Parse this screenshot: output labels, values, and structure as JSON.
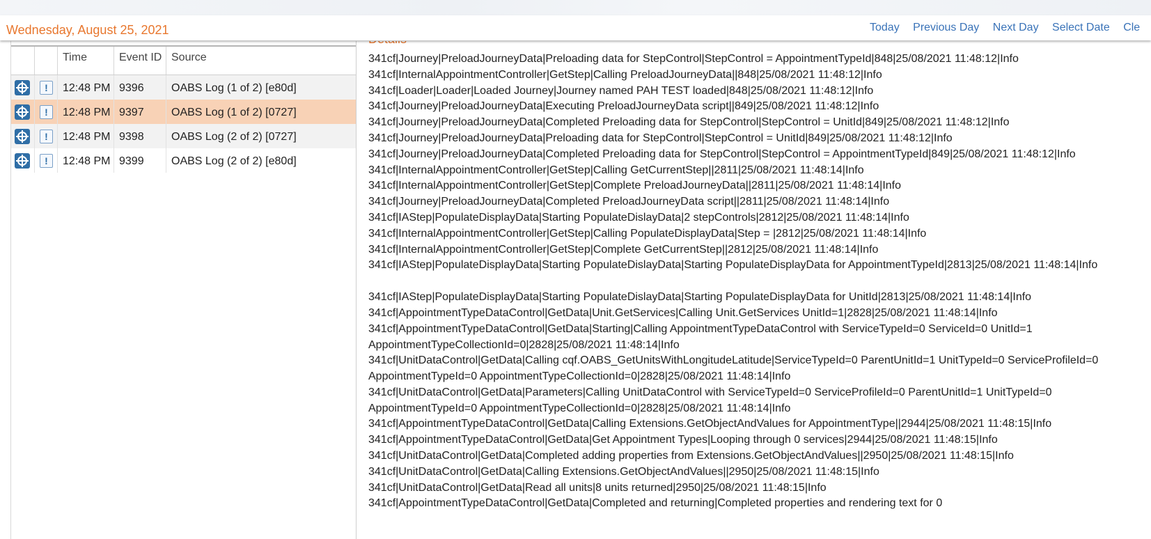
{
  "header": {
    "date": "Wednesday, August 25, 2021",
    "nav": [
      "Today",
      "Previous Day",
      "Next Day",
      "Select Date",
      "Cle"
    ]
  },
  "events_table": {
    "columns": [
      "",
      "",
      "Time",
      "Event ID",
      "Source"
    ],
    "rows": [
      {
        "time": "12:48 PM",
        "event_id": "9396",
        "source": "OABS Log (1 of 2) [e80d]",
        "selected": false
      },
      {
        "time": "12:48 PM",
        "event_id": "9397",
        "source": "OABS Log (1 of 2) [0727]",
        "selected": true
      },
      {
        "time": "12:48 PM",
        "event_id": "9398",
        "source": "OABS Log (2 of 2) [0727]",
        "selected": false
      },
      {
        "time": "12:48 PM",
        "event_id": "9399",
        "source": "OABS Log (2 of 2) [e80d]",
        "selected": false
      }
    ],
    "row_icons": [
      "target-icon",
      "info-icon"
    ]
  },
  "details": {
    "heading": "Details",
    "lines": [
      "341cf|Journey|PreloadJourneyData|Preloading data for StepControl|StepControl = AppointmentTypeId|848|25/08/2021 11:48:12|Info",
      "341cf|InternalAppointmentController|GetStep|Calling PreloadJourneyData||848|25/08/2021 11:48:12|Info",
      "341cf|Loader|Loader|Loaded Journey|Journey named PAH TEST loaded|848|25/08/2021 11:48:12|Info",
      "341cf|Journey|PreloadJourneyData|Executing PreloadJourneyData script||849|25/08/2021 11:48:12|Info",
      "341cf|Journey|PreloadJourneyData|Completed Preloading data for StepControl|StepControl = UnitId|849|25/08/2021 11:48:12|Info",
      "341cf|Journey|PreloadJourneyData|Preloading data for StepControl|StepControl = UnitId|849|25/08/2021 11:48:12|Info",
      "341cf|Journey|PreloadJourneyData|Completed Preloading data for StepControl|StepControl = AppointmentTypeId|849|25/08/2021 11:48:12|Info",
      "341cf|InternalAppointmentController|GetStep|Calling GetCurrentStep||2811|25/08/2021 11:48:14|Info",
      "341cf|InternalAppointmentController|GetStep|Complete PreloadJourneyData||2811|25/08/2021 11:48:14|Info",
      "341cf|Journey|PreloadJourneyData|Completed PreloadJourneyData script||2811|25/08/2021 11:48:14|Info",
      "341cf|IAStep|PopulateDisplayData|Starting PopulateDislayData|2 stepControls|2812|25/08/2021 11:48:14|Info",
      "341cf|InternalAppointmentController|GetStep|Calling PopulateDisplayData|Step = |2812|25/08/2021 11:48:14|Info",
      "341cf|InternalAppointmentController|GetStep|Complete GetCurrentStep||2812|25/08/2021 11:48:14|Info",
      "341cf|IAStep|PopulateDisplayData|Starting PopulateDislayData|Starting PopulateDisplayData for AppointmentTypeId|2813|25/08/2021 11:48:14|Info",
      "341cf|IAStep|PopulateDisplayData|Starting PopulateDislayData|Starting PopulateDisplayData for UnitId|2813|25/08/2021 11:48:14|Info",
      "341cf|AppointmentTypeDataControl|GetData|Unit.GetServices|Calling Unit.GetServices UnitId=1|2828|25/08/2021 11:48:14|Info",
      "341cf|AppointmentTypeDataControl|GetData|Starting|Calling AppointmentTypeDataControl with ServiceTypeId=0 ServiceId=0 UnitId=1 AppointmentTypeCollectionId=0|2828|25/08/2021 11:48:14|Info",
      "341cf|UnitDataControl|GetData|Calling cqf.OABS_GetUnitsWithLongitudeLatitude|ServiceTypeId=0 ParentUnitId=1 UnitTypeId=0 ServiceProfileId=0 AppointmentTypeId=0 AppointmentTypeCollectionId=0|2828|25/08/2021 11:48:14|Info",
      "341cf|UnitDataControl|GetData|Parameters|Calling UnitDataControl with ServiceTypeId=0 ServiceProfileId=0 ParentUnitId=1 UnitTypeId=0 AppointmentTypeId=0 AppointmentTypeCollectionId=0|2828|25/08/2021 11:48:14|Info",
      "341cf|AppointmentTypeDataControl|GetData|Calling Extensions.GetObjectAndValues for AppointmentType||2944|25/08/2021 11:48:15|Info",
      "341cf|AppointmentTypeDataControl|GetData|Get Appointment Types|Looping through 0 services|2944|25/08/2021 11:48:15|Info",
      "341cf|UnitDataControl|GetData|Completed adding properties from Extensions.GetObjectAndValues||2950|25/08/2021 11:48:15|Info",
      "341cf|UnitDataControl|GetData|Calling Extensions.GetObjectAndValues||2950|25/08/2021 11:48:15|Info",
      "341cf|UnitDataControl|GetData|Read all units|8 units returned|2950|25/08/2021 11:48:15|Info",
      "341cf|AppointmentTypeDataControl|GetData|Completed and returning|Completed properties and rendering text for 0"
    ]
  },
  "colors": {
    "accent_orange": "#e8772e",
    "link_blue": "#3a73b8",
    "selected_row": "#f8d2b6",
    "zebra_row": "#f2f2f2",
    "icon_blue": "#2f6ea6"
  }
}
